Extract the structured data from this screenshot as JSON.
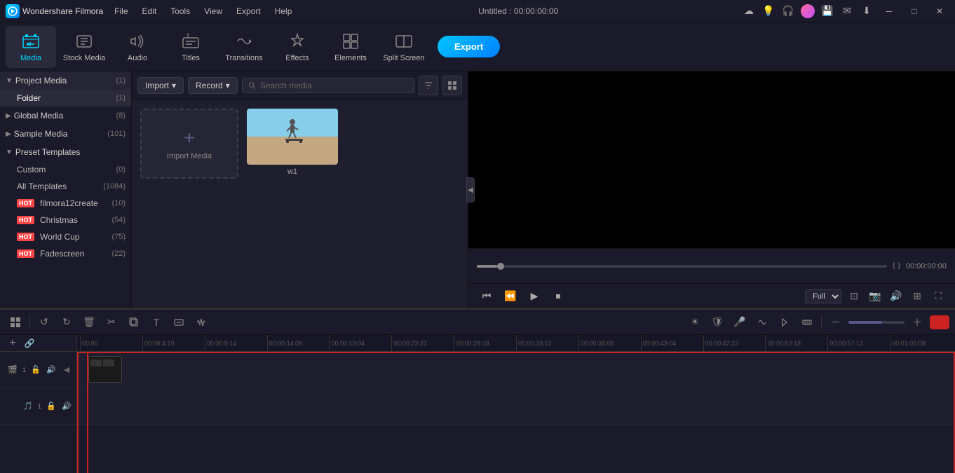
{
  "app": {
    "name": "Wondershare Filmora",
    "title": "Untitled : 00:00:00:00"
  },
  "menu": {
    "items": [
      "File",
      "Edit",
      "Tools",
      "View",
      "Export",
      "Help"
    ]
  },
  "toolbar": {
    "export_label": "Export",
    "items": [
      {
        "id": "media",
        "label": "Media",
        "icon": "📁",
        "active": true
      },
      {
        "id": "stock",
        "label": "Stock Media",
        "icon": "🎬"
      },
      {
        "id": "audio",
        "label": "Audio",
        "icon": "🎵"
      },
      {
        "id": "titles",
        "label": "Titles",
        "icon": "T"
      },
      {
        "id": "transitions",
        "label": "Transitions",
        "icon": "⟷"
      },
      {
        "id": "effects",
        "label": "Effects",
        "icon": "✨"
      },
      {
        "id": "elements",
        "label": "Elements",
        "icon": "◈"
      },
      {
        "id": "split",
        "label": "Split Screen",
        "icon": "⊞"
      }
    ]
  },
  "sidebar": {
    "sections": [
      {
        "id": "project-media",
        "label": "Project Media",
        "count": "(1)",
        "expanded": true,
        "children": [
          {
            "id": "folder",
            "label": "Folder",
            "count": "(1)",
            "active": true
          }
        ]
      },
      {
        "id": "global-media",
        "label": "Global Media",
        "count": "(8)",
        "expanded": false
      },
      {
        "id": "sample-media",
        "label": "Sample Media",
        "count": "(101)",
        "expanded": false
      },
      {
        "id": "preset-templates",
        "label": "Preset Templates",
        "count": "",
        "expanded": true,
        "children": [
          {
            "id": "custom",
            "label": "Custom",
            "count": "(0)"
          },
          {
            "id": "all-templates",
            "label": "All Templates",
            "count": "(1084)"
          },
          {
            "id": "filmora12create",
            "label": "filmora12create",
            "count": "(10)",
            "hot": true
          },
          {
            "id": "christmas",
            "label": "Christmas",
            "count": "(54)",
            "hot": true
          },
          {
            "id": "world-cup",
            "label": "World Cup",
            "count": "(75)",
            "hot": true
          },
          {
            "id": "fadescreen",
            "label": "Fadescreen",
            "count": "(22)",
            "hot": true
          }
        ]
      }
    ]
  },
  "media_panel": {
    "import_btn": "Import",
    "record_btn": "Record",
    "search_placeholder": "Search media",
    "import_media_label": "Import Media",
    "media_items": [
      {
        "id": "w1",
        "label": "w1"
      }
    ]
  },
  "preview": {
    "time": "00:00:00:00",
    "quality": "Full",
    "progress_percent": 5
  },
  "timeline": {
    "timestamps": [
      "00:00",
      "00:00:4:19",
      "00:00:9:14",
      "00:00:14:09",
      "00:00:19:04",
      "00:00:23:23",
      "00:00:28:18",
      "00:00:33:13",
      "00:00:38:08",
      "00:00:43:04",
      "00:00:47:23",
      "00:00:52:18",
      "00:00:57:13",
      "00:01:02:08"
    ]
  },
  "titlebar_icons": {
    "cloud": "☁",
    "bulb": "💡",
    "headphone": "🎧",
    "save": "💾",
    "mail": "✉",
    "download": "⬇"
  },
  "win_controls": {
    "minimize": "─",
    "maximize": "□",
    "close": "✕"
  }
}
